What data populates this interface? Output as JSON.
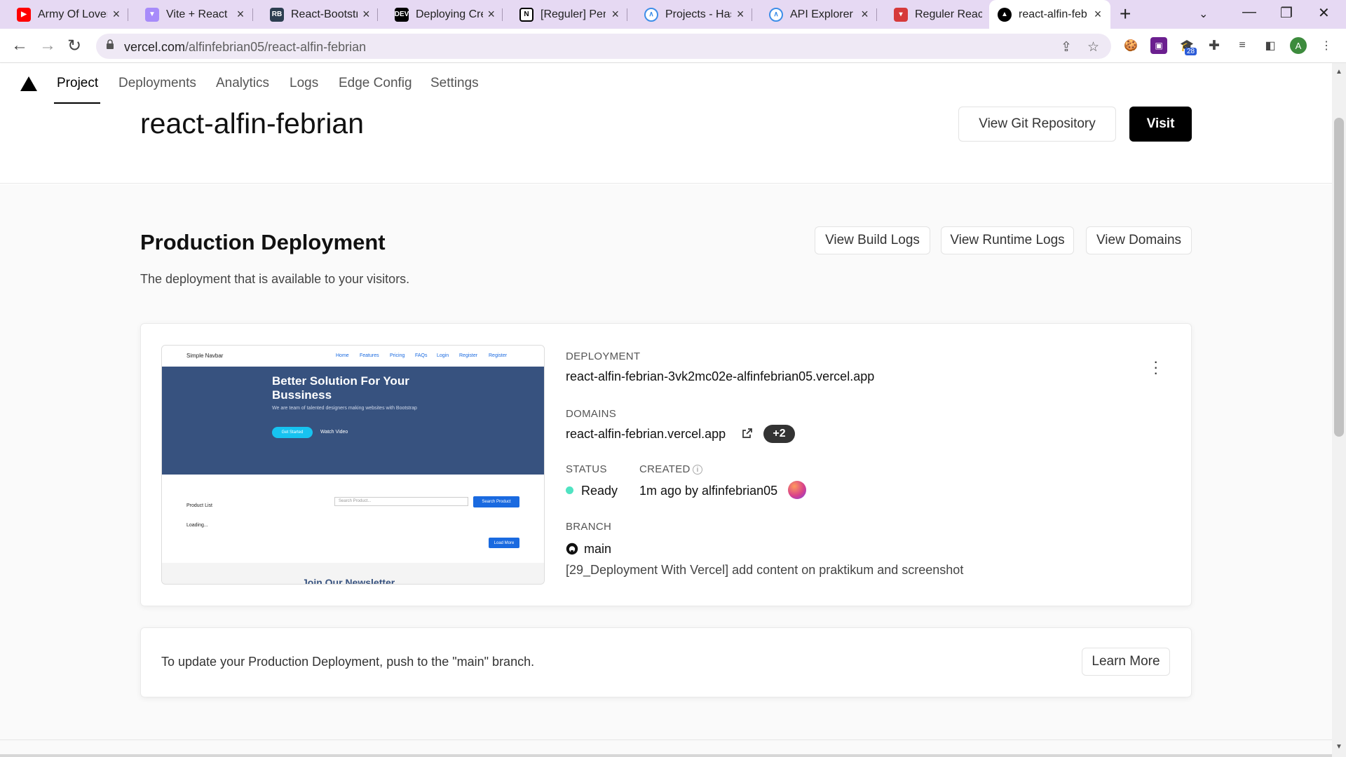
{
  "browser": {
    "tabs": [
      {
        "title": "Army Of Lovers",
        "icon": "youtube-icon",
        "color": "#ff0000"
      },
      {
        "title": "Vite + React",
        "icon": "vite-icon",
        "color": "#8b5cf6"
      },
      {
        "title": "React-Bootstrap",
        "icon": "react-bootstrap-icon",
        "color": "#2c3e50"
      },
      {
        "title": "Deploying Create",
        "icon": "dev-icon",
        "color": "#000000"
      },
      {
        "title": "[Reguler] Pem",
        "icon": "notion-icon",
        "color": "#000000"
      },
      {
        "title": "Projects - Hash",
        "icon": "hasura-icon",
        "color": "#3e8ee8"
      },
      {
        "title": "API Explorer |",
        "icon": "hasura-icon",
        "color": "#3e8ee8"
      },
      {
        "title": "Reguler React",
        "icon": "tie-icon",
        "color": "#d63a3a"
      },
      {
        "title": "react-alfin-feb",
        "icon": "vercel-icon",
        "color": "#000000"
      }
    ],
    "url_host": "vercel.com",
    "url_path": "/alfinfebrian05/react-alfin-febrian",
    "extension_badge": "28",
    "profile_initial": "A"
  },
  "project_nav": {
    "tabs": [
      "Project",
      "Deployments",
      "Analytics",
      "Logs",
      "Edge Config",
      "Settings"
    ],
    "active": "Project"
  },
  "header": {
    "project_name": "react-alfin-febrian",
    "git_button": "View Git Repository",
    "visit_button": "Visit"
  },
  "production": {
    "title": "Production Deployment",
    "subtitle": "The deployment that is available to your visitors.",
    "build_logs_button": "View Build Logs",
    "runtime_logs_button": "View Runtime Logs",
    "domains_button": "View Domains"
  },
  "preview": {
    "brand": "Simple Navbar",
    "nav_links": [
      "Home",
      "Features",
      "Pricing",
      "FAQs",
      "Login",
      "Register",
      "Register"
    ],
    "hero_title": "Better Solution For Your Bussiness",
    "hero_text": "We are team of talented designers making websites with Bootstrap",
    "get_started": "Get Started",
    "watch_video": "Watch Video",
    "product_list": "Product List",
    "search_placeholder": "Search Product...",
    "search_button": "Search Product",
    "loading": "Loading...",
    "load_more": "Load More",
    "newsletter": "Join Our Newsletter"
  },
  "deployment": {
    "deployment_label": "DEPLOYMENT",
    "deployment_url": "react-alfin-febrian-3vk2mc02e-alfinfebrian05.vercel.app",
    "domains_label": "DOMAINS",
    "domain": "react-alfin-febrian.vercel.app",
    "extra_domains": "+2",
    "status_label": "STATUS",
    "status": "Ready",
    "created_label": "CREATED",
    "created": "1m ago by alfinfebrian05",
    "branch_label": "BRANCH",
    "branch": "main",
    "commit_message": "[29_Deployment With Vercel] add content on praktikum and screenshot"
  },
  "info_card": {
    "text": "To update your Production Deployment, push to the \"main\" branch.",
    "learn_more": "Learn More"
  }
}
